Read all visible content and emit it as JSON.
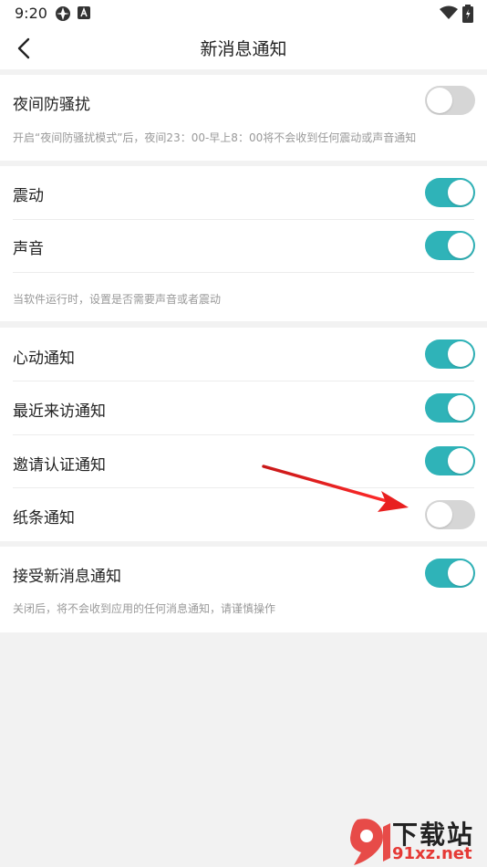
{
  "status_bar": {
    "time": "9:20"
  },
  "header": {
    "title": "新消息通知"
  },
  "sections": {
    "night": {
      "label": "夜间防骚扰",
      "toggle_on": false,
      "note": "开启“夜间防骚扰模式”后，夜间23：00-早上8：00将不会收到任何震动或声音通知"
    },
    "alert": {
      "vibration_label": "震动",
      "vibration_on": true,
      "sound_label": "声音",
      "sound_on": true,
      "note": "当软件运行时，设置是否需要声音或者震动"
    },
    "types": {
      "heart_label": "心动通知",
      "heart_on": true,
      "visit_label": "最近来访通知",
      "visit_on": true,
      "invite_label": "邀请认证通知",
      "invite_on": true,
      "note_label": "纸条通知",
      "note_on": false
    },
    "accept": {
      "label": "接受新消息通知",
      "toggle_on": true,
      "note": "关闭后，将不会收到应用的任何消息通知，请谨慎操作"
    }
  },
  "watermark": {
    "brand": "下载站",
    "domain": "91xz.net"
  },
  "colors": {
    "accent": "#2fb3b8",
    "toggle_off": "#d6d6d6",
    "arrow": "#e02020"
  }
}
